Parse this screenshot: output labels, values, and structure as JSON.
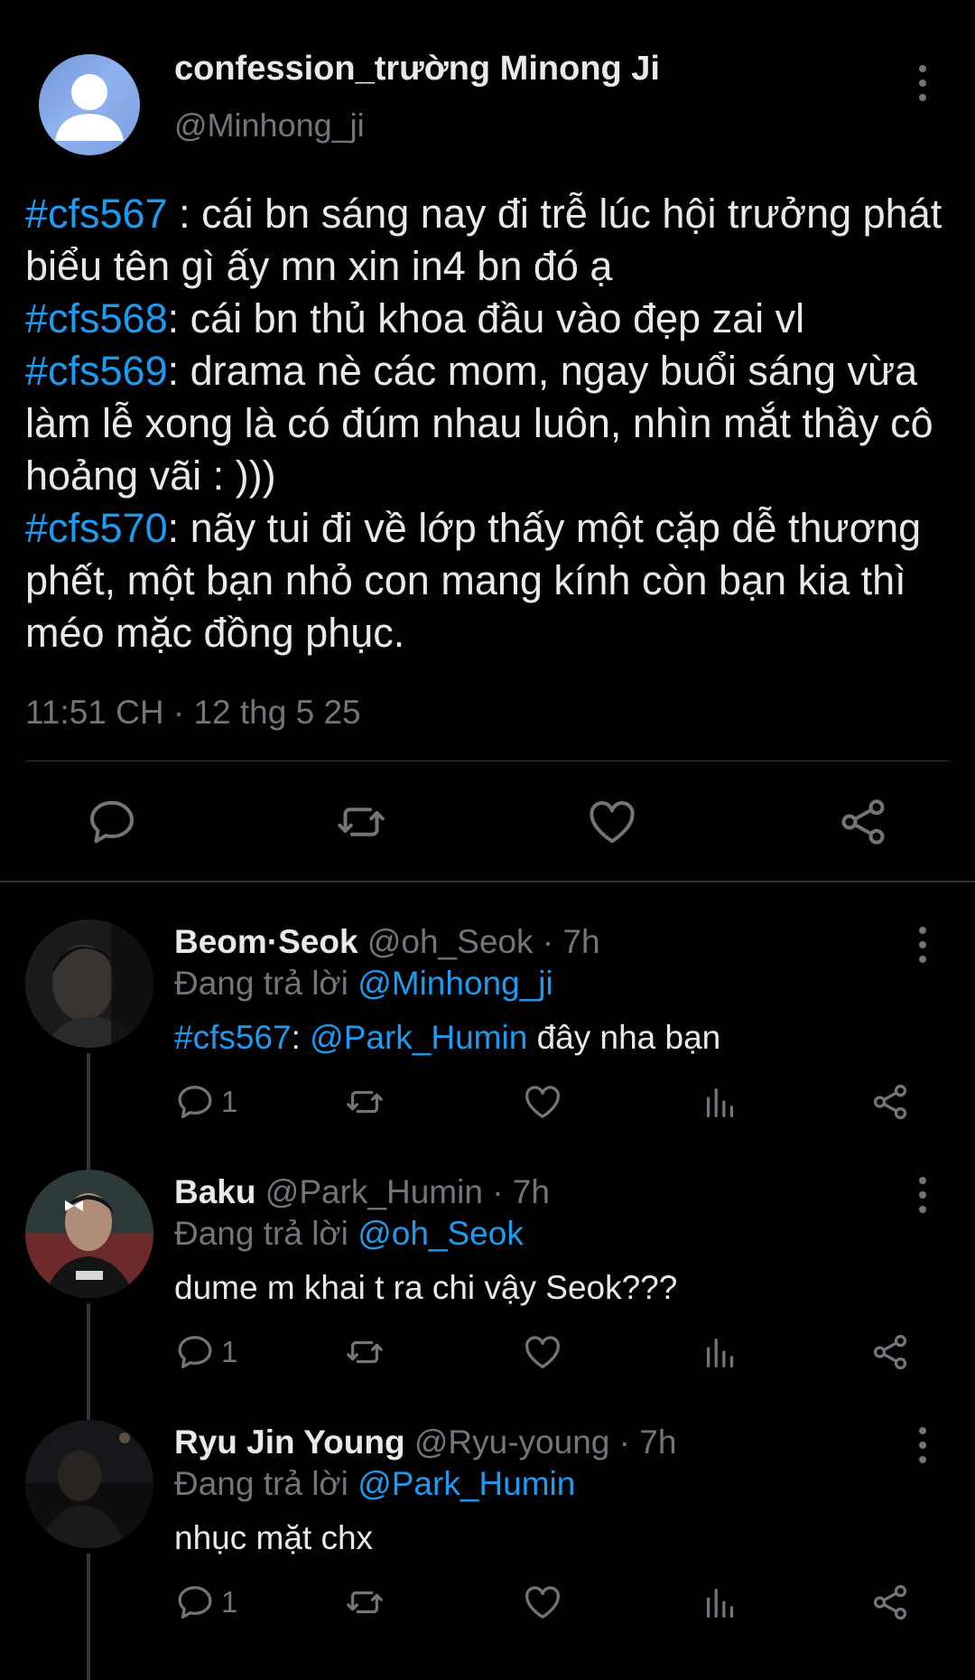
{
  "tweet": {
    "display_name": "confession_trường Minong Ji",
    "handle": "@Minhong_ji",
    "lines": [
      {
        "tag": "#cfs567",
        "text": " : cái bn sáng nay đi trễ lúc hội trưởng phát biểu tên gì ấy mn xin in4 bn đó ạ"
      },
      {
        "tag": "#cfs568",
        "text": ": cái bn thủ khoa đầu vào đẹp zai vl"
      },
      {
        "tag": "#cfs569",
        "text": ": drama nè các mom, ngay buổi sáng vừa làm lễ xong là có đúm nhau luôn, nhìn mắt thầy cô hoảng vãi : )))"
      },
      {
        "tag": "#cfs570",
        "text": ": nãy tui đi về lớp thấy một cặp dễ thương phết, một bạn nhỏ con mang kính còn bạn kia thì méo mặc đồng phục."
      }
    ],
    "timestamp": "11:51 CH · 12 thg 5 25",
    "actions": [
      "comment-icon",
      "retweet-icon",
      "like-icon",
      "share-icon"
    ]
  },
  "replies": [
    {
      "name": "Beom·Seok",
      "handle": "@oh_Seok",
      "time": "· 7h",
      "replying_prefix": "Đang trả lời ",
      "replying_to": "@Minhong_ji",
      "tag": "#cfs567",
      "sep": ": ",
      "mention": "@Park_Humin",
      "text": " đây nha bạn",
      "reply_count": "1"
    },
    {
      "name": "Baku",
      "handle": "@Park_Humin",
      "time": "· 7h",
      "replying_prefix": "Đang trả lời ",
      "replying_to": "@oh_Seok",
      "text": "dume m khai t ra chi vậy Seok???",
      "reply_count": "1"
    },
    {
      "name": "Ryu Jin Young",
      "handle": "@Ryu-young",
      "time": "· 7h",
      "replying_prefix": "Đang trả lời ",
      "replying_to": "@Park_Humin",
      "text": "nhục mặt chx",
      "reply_count": "1"
    }
  ],
  "colors": {
    "background": "#000000",
    "text": "#e7e9ea",
    "muted": "#71767b",
    "accent": "#1d9bf0",
    "divider": "#2f3336"
  }
}
